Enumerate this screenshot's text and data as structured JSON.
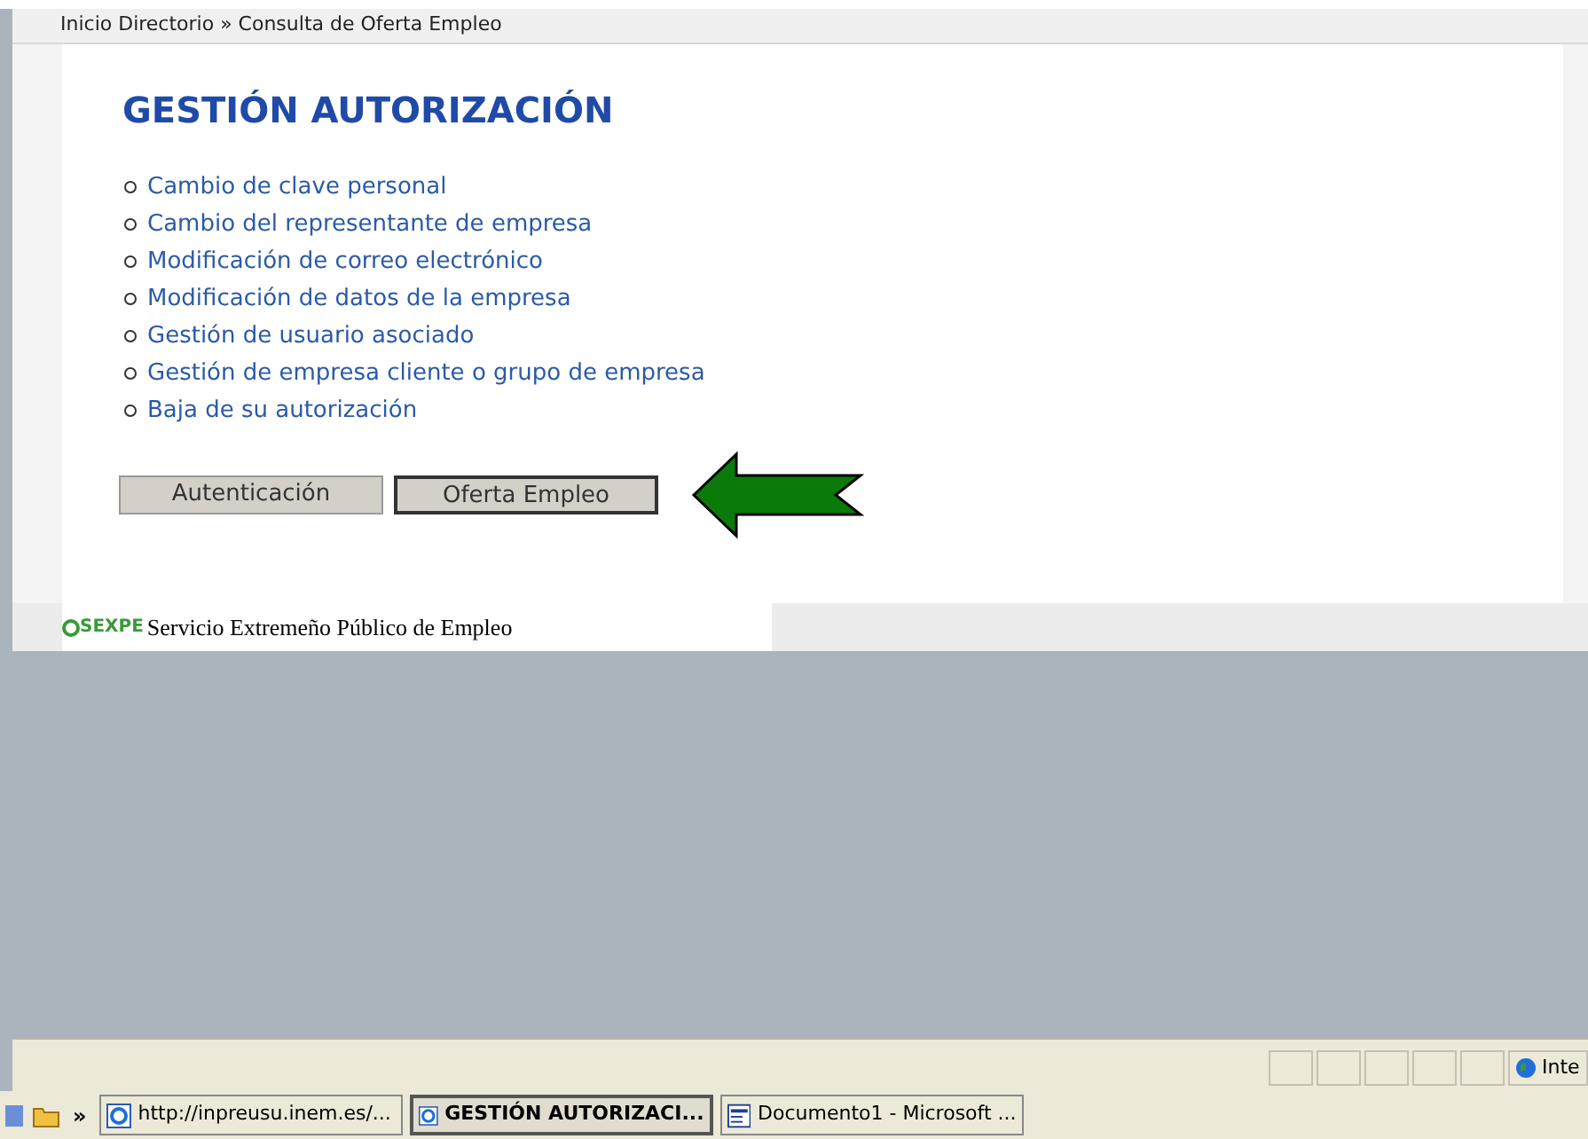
{
  "breadcrumb": "Inicio Directorio » Consulta de Oferta Empleo",
  "title": "GESTIÓN AUTORIZACIÓN",
  "menu_items": [
    "Cambio de clave personal",
    "Cambio del representante de empresa",
    "Modificación de correo electrónico",
    "Modificación de datos de la empresa",
    "Gestión de usuario asociado",
    "Gestión de empresa cliente o grupo de empresa",
    "Baja de su autorización"
  ],
  "buttons": [
    {
      "label": "Autenticación",
      "focused": false
    },
    {
      "label": "Oferta Empleo",
      "focused": true
    }
  ],
  "footer": {
    "logo": "SEXPE",
    "text": "Servicio Extremeño Público de Empleo"
  },
  "status_bar": {
    "zone": "Inte"
  },
  "taskbar": {
    "chevron": "»",
    "tasks": [
      {
        "label": "http://inpreusu.inem.es/...",
        "kind": "browser",
        "selected": false
      },
      {
        "label": "GESTIÓN AUTORIZACI...",
        "kind": "browser",
        "selected": true
      },
      {
        "label": "Documento1 - Microsoft ...",
        "kind": "document",
        "selected": false
      }
    ]
  }
}
